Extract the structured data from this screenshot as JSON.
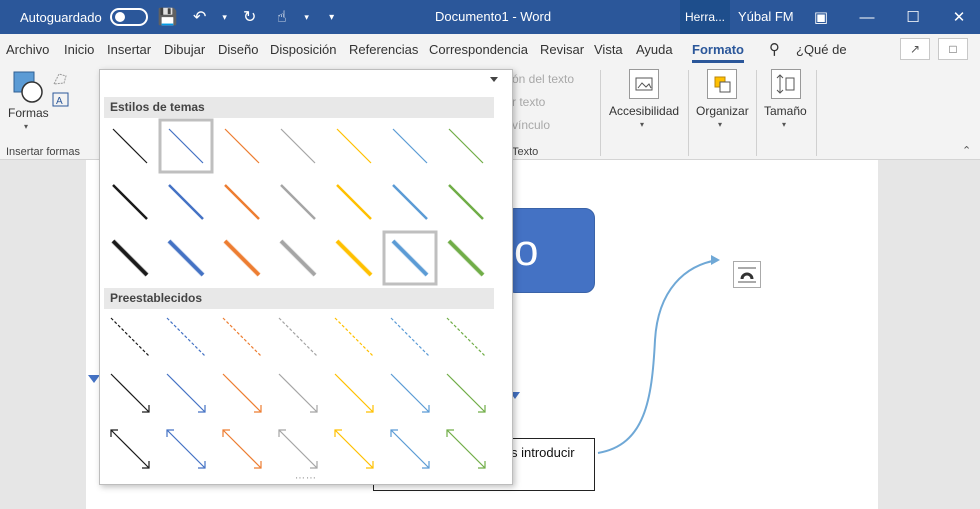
{
  "titlebar": {
    "autosave_label": "Autoguardado",
    "doc_title": "Documento1  -  Word",
    "tools_tab": "Herra...",
    "user": "Yúbal FM",
    "icons": [
      "save-icon",
      "undo-icon",
      "redo-icon",
      "touch-icon",
      "customize-icon"
    ]
  },
  "menu": {
    "tabs": [
      "Archivo",
      "Inicio",
      "Insertar",
      "Dibujar",
      "Diseño",
      "Disposición",
      "Referencias",
      "Correspondencia",
      "Revisar",
      "Vista",
      "Ayuda",
      "Formato"
    ],
    "active_tab": "Formato",
    "search_label": "¿Qué de"
  },
  "ribbon": {
    "shapes_label": "Formas",
    "insert_shapes_group": "Insertar formas",
    "text_direction": "ón del texto",
    "align_text": "r texto",
    "link": "vínculo",
    "text_group": "Texto",
    "accessibility": "Accesibilidad",
    "arrange": "Organizar",
    "size": "Tamaño"
  },
  "panel": {
    "theme_styles_label": "Estilos de temas",
    "presets_label": "Preestablecidos"
  },
  "document": {
    "shape_text": "o",
    "textbox_text": "s introducir"
  },
  "colors": {
    "black": "#1a1a1a",
    "blue": "#4472c4",
    "orange": "#ed7d31",
    "gray": "#a5a5a5",
    "gold": "#ffc000",
    "lightblue": "#5b9bd5",
    "green": "#70ad47",
    "accent": "#2b579a"
  }
}
